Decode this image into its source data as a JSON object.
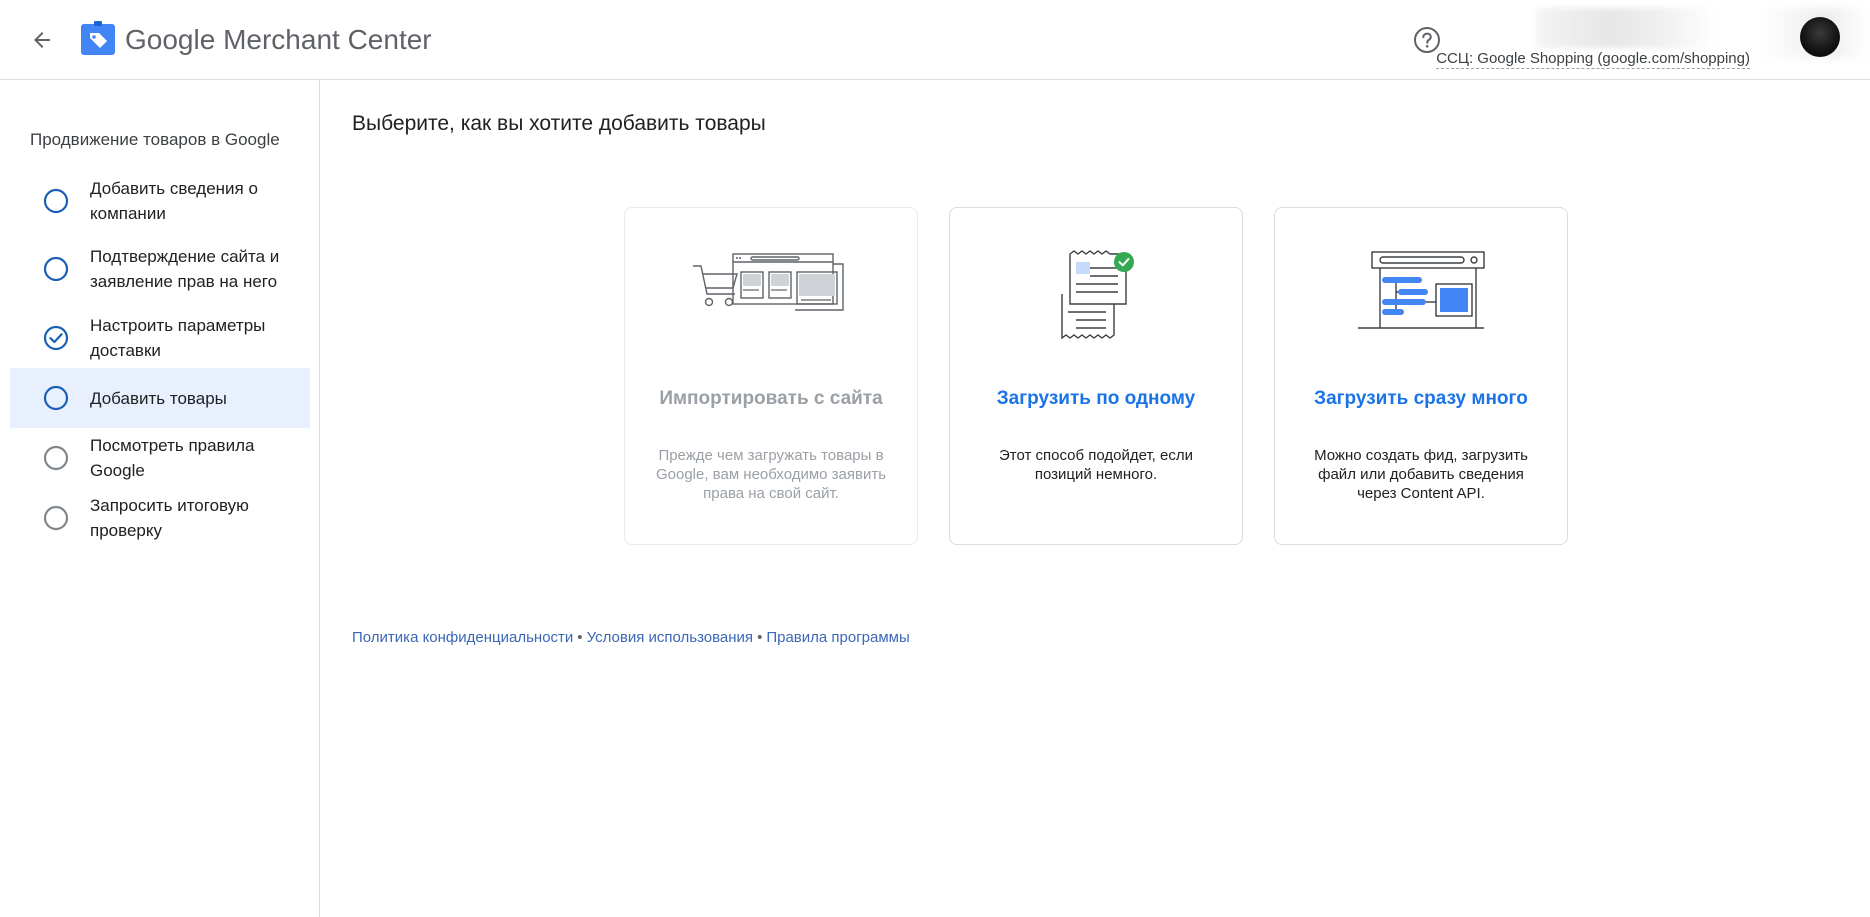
{
  "header": {
    "brand_google": "Google",
    "brand_product": "Merchant Center",
    "account_label": "ССЦ: Google Shopping (google.com/shopping)",
    "icons": {
      "back": "arrow-left-icon",
      "logo": "merchant-center-tag-icon",
      "help": "help-circle-icon"
    }
  },
  "sidebar": {
    "title": "Продвижение товаров в Google",
    "steps": [
      {
        "label": "Добавить сведения о компании",
        "state": "pending"
      },
      {
        "label": "Подтверждение сайта и заявление прав на него",
        "state": "pending"
      },
      {
        "label": "Настроить параметры доставки",
        "state": "done"
      },
      {
        "label": "Добавить товары",
        "state": "current"
      },
      {
        "label": "Посмотреть правила Google",
        "state": "disabled"
      },
      {
        "label": "Запросить итоговую проверку",
        "state": "disabled"
      }
    ]
  },
  "main": {
    "title": "Выберите, как вы хотите добавить товары",
    "cards": [
      {
        "title": "Импортировать с сайта",
        "description": "Прежде чем загружать товары в Google, вам необходимо заявить права на свой сайт.",
        "enabled": false
      },
      {
        "title": "Загрузить по одному",
        "description": "Этот способ подойдет, если позиций немного.",
        "enabled": true
      },
      {
        "title": "Загрузить сразу много",
        "description": "Можно создать фид, загрузить файл или добавить сведения через Content API.",
        "enabled": true
      }
    ]
  },
  "footer": {
    "privacy": "Политика конфиденциальности",
    "terms": "Условия использования",
    "program": "Правила программы",
    "separator": "•"
  },
  "colors": {
    "accent": "#1a73e8",
    "active_bg": "#e8f0fe",
    "disabled": "#9aa0a6",
    "success": "#34a853",
    "brand_icon": "#4285f4"
  }
}
